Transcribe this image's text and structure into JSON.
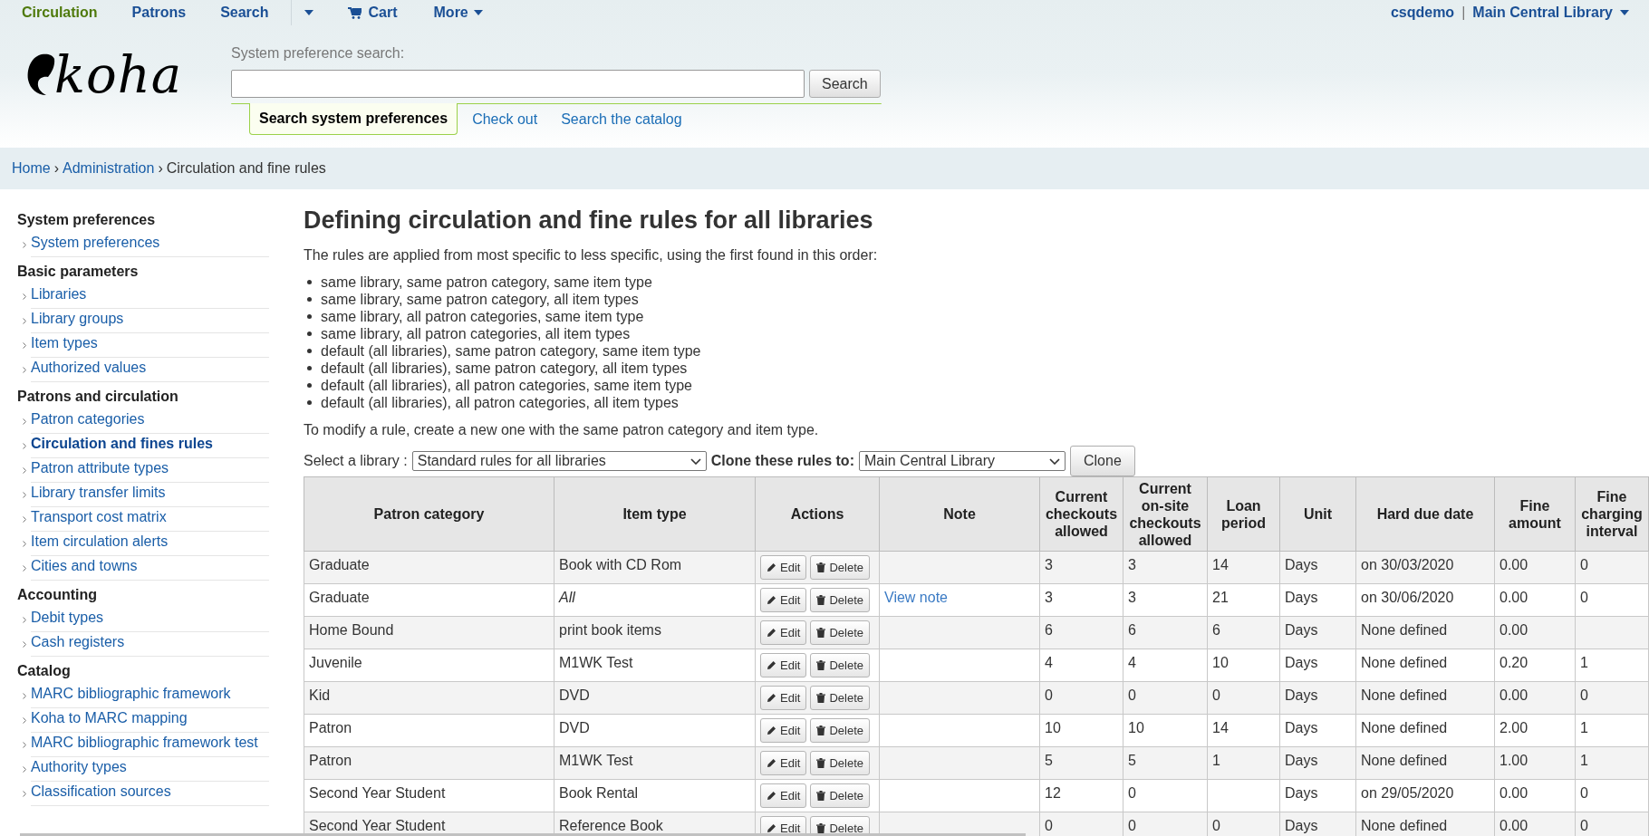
{
  "top_nav": [
    {
      "kind": "link",
      "label": "Circulation",
      "selected": true
    },
    {
      "kind": "link",
      "label": "Patrons",
      "selected": false
    },
    {
      "kind": "link",
      "label": "Search",
      "selected": false
    },
    {
      "kind": "caret",
      "selected": false
    },
    {
      "kind": "cart",
      "label": "Cart",
      "selected": false
    },
    {
      "kind": "menu",
      "label": "More",
      "selected": false
    }
  ],
  "user": {
    "name": "csqdemo",
    "separator": "|",
    "library": "Main Central Library"
  },
  "logo": "koha",
  "pref_search": {
    "label": "System preference search:",
    "button": "Search"
  },
  "header_tabs": [
    {
      "label": "Search system preferences",
      "selected": true
    },
    {
      "label": "Check out",
      "selected": false
    },
    {
      "label": "Search the catalog",
      "selected": false
    }
  ],
  "breadcrumbs": [
    {
      "label": "Home",
      "link": true
    },
    {
      "label": "›",
      "link": false
    },
    {
      "label": "Administration",
      "link": true
    },
    {
      "label": "›",
      "link": false
    },
    {
      "label": "Circulation and fine rules",
      "link": false
    }
  ],
  "sidebar": [
    {
      "heading": "System preferences",
      "items": [
        {
          "label": "System preferences",
          "selected": false
        }
      ]
    },
    {
      "heading": "Basic parameters",
      "items": [
        {
          "label": "Libraries",
          "selected": false
        },
        {
          "label": "Library groups",
          "selected": false
        },
        {
          "label": "Item types",
          "selected": false
        },
        {
          "label": "Authorized values",
          "selected": false
        }
      ]
    },
    {
      "heading": "Patrons and circulation",
      "items": [
        {
          "label": "Patron categories",
          "selected": false
        },
        {
          "label": "Circulation and fines rules",
          "selected": true
        },
        {
          "label": "Patron attribute types",
          "selected": false
        },
        {
          "label": "Library transfer limits",
          "selected": false
        },
        {
          "label": "Transport cost matrix",
          "selected": false
        },
        {
          "label": "Item circulation alerts",
          "selected": false
        },
        {
          "label": "Cities and towns",
          "selected": false
        }
      ]
    },
    {
      "heading": "Accounting",
      "items": [
        {
          "label": "Debit types",
          "selected": false
        },
        {
          "label": "Cash registers",
          "selected": false
        }
      ]
    },
    {
      "heading": "Catalog",
      "items": [
        {
          "label": "MARC bibliographic framework",
          "selected": false
        },
        {
          "label": "Koha to MARC mapping",
          "selected": false
        },
        {
          "label": "MARC bibliographic framework test",
          "selected": false
        },
        {
          "label": "Authority types",
          "selected": false
        },
        {
          "label": "Classification sources",
          "selected": false
        }
      ]
    }
  ],
  "title": "Defining circulation and fine rules for all libraries",
  "intro": "The rules are applied from most specific to less specific, using the first found in this order:",
  "order": [
    "same library, same patron category, same item type",
    "same library, same patron category, all item types",
    "same library, all patron categories, same item type",
    "same library, all patron categories, all item types",
    "default (all libraries), same patron category, same item type",
    "default (all libraries), same patron category, all item types",
    "default (all libraries), all patron categories, same item type",
    "default (all libraries), all patron categories, all item types"
  ],
  "modify_note": "To modify a rule, create a new one with the same patron category and item type.",
  "library_select": {
    "label": "Select a library :",
    "value": "Standard rules for all libraries"
  },
  "clone": {
    "label": "Clone these rules to:",
    "value": "Main Central Library",
    "button": "Clone"
  },
  "table": {
    "columns": [
      "Patron category",
      "Item type",
      "Actions",
      "Note",
      "Current checkouts allowed",
      "Current on-site checkouts allowed",
      "Loan period",
      "Unit",
      "Hard due date",
      "Fine amount",
      "Fine charging interval"
    ],
    "rows": [
      {
        "patron_category": "Graduate",
        "item_type": "Book with CD Rom",
        "item_type_all": false,
        "actions": [
          "Edit",
          "Delete"
        ],
        "checkouts": "3",
        "onsite": "3",
        "loan_period": "14",
        "unit": "Days",
        "hard_due_date": "on 30/03/2020",
        "fine_amount": "0.00",
        "fine_interval": "0"
      },
      {
        "patron_category": "Graduate",
        "item_type": "All",
        "item_type_all": true,
        "actions": [
          "Edit",
          "Delete"
        ],
        "note": "View note",
        "checkouts": "3",
        "onsite": "3",
        "loan_period": "21",
        "unit": "Days",
        "hard_due_date": "on 30/06/2020",
        "fine_amount": "0.00",
        "fine_interval": "0"
      },
      {
        "patron_category": "Home Bound",
        "item_type": "print book items",
        "item_type_all": false,
        "actions": [
          "Edit",
          "Delete"
        ],
        "checkouts": "6",
        "onsite": "6",
        "loan_period": "6",
        "unit": "Days",
        "hard_due_date": "None defined",
        "fine_amount": "0.00"
      },
      {
        "patron_category": "Juvenile",
        "item_type": "M1WK Test",
        "item_type_all": false,
        "actions": [
          "Edit",
          "Delete"
        ],
        "checkouts": "4",
        "onsite": "4",
        "loan_period": "10",
        "unit": "Days",
        "hard_due_date": "None defined",
        "fine_amount": "0.20",
        "fine_interval": "1"
      },
      {
        "patron_category": "Kid",
        "item_type": "DVD",
        "item_type_all": false,
        "actions": [
          "Edit",
          "Delete"
        ],
        "checkouts": "0",
        "onsite": "0",
        "loan_period": "0",
        "unit": "Days",
        "hard_due_date": "None defined",
        "fine_amount": "0.00",
        "fine_interval": "0"
      },
      {
        "patron_category": "Patron",
        "item_type": "DVD",
        "item_type_all": false,
        "actions": [
          "Edit",
          "Delete"
        ],
        "checkouts": "10",
        "onsite": "10",
        "loan_period": "14",
        "unit": "Days",
        "hard_due_date": "None defined",
        "fine_amount": "2.00",
        "fine_interval": "1"
      },
      {
        "patron_category": "Patron",
        "item_type": "M1WK Test",
        "item_type_all": false,
        "actions": [
          "Edit",
          "Delete"
        ],
        "checkouts": "5",
        "onsite": "5",
        "loan_period": "1",
        "unit": "Days",
        "hard_due_date": "None defined",
        "fine_amount": "1.00",
        "fine_interval": "1"
      },
      {
        "patron_category": "Second Year Student",
        "item_type": "Book Rental",
        "item_type_all": false,
        "actions": [
          "Edit",
          "Delete"
        ],
        "checkouts": "12",
        "onsite": "0",
        "unit": "Days",
        "hard_due_date": "on 29/05/2020",
        "fine_amount": "0.00",
        "fine_interval": "0"
      },
      {
        "patron_category": "Second Year Student",
        "item_type": "Reference Book",
        "item_type_all": false,
        "actions": [
          "Edit",
          "Delete"
        ],
        "checkouts": "0",
        "onsite": "0",
        "loan_period": "0",
        "unit": "Days",
        "hard_due_date": "None defined",
        "fine_amount": "0.00",
        "fine_interval": "0"
      }
    ]
  }
}
